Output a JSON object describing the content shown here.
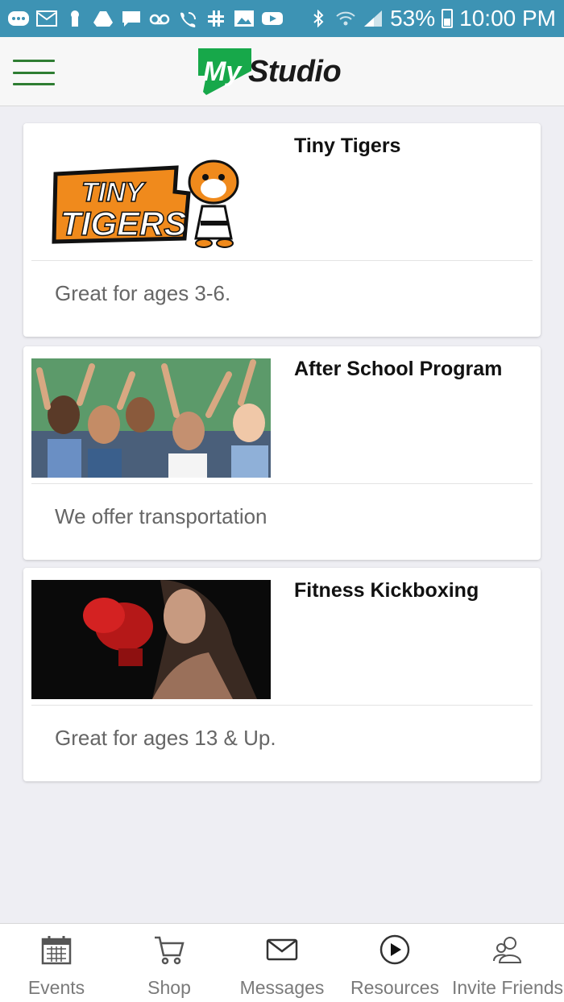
{
  "status_bar": {
    "battery_percent": "53%",
    "time": "10:00 PM",
    "icons": [
      "more-icon",
      "gmail-icon",
      "keyhole-icon",
      "drive-icon",
      "chat-icon",
      "voicemail-icon",
      "wifi-call-icon",
      "slack-icon",
      "image-icon",
      "youtube-icon",
      "bluetooth-icon",
      "wifi-icon",
      "signal-icon",
      "battery-icon"
    ]
  },
  "header": {
    "logo_my": "My",
    "logo_studio": "Studio",
    "brand_color": "#17a84a",
    "menu_color": "#2e7d32"
  },
  "cards": [
    {
      "title": "Tiny Tigers",
      "description": "Great for ages 3-6.",
      "image_text": "TINY TIGERS"
    },
    {
      "title": "After School Program",
      "description": "We offer transportation"
    },
    {
      "title": "Fitness Kickboxing",
      "description": "Great for ages 13 & Up."
    }
  ],
  "bottom_nav": [
    {
      "label": "Events",
      "icon": "calendar-icon"
    },
    {
      "label": "Shop",
      "icon": "cart-icon"
    },
    {
      "label": "Messages",
      "icon": "envelope-icon"
    },
    {
      "label": "Resources",
      "icon": "play-circle-icon"
    },
    {
      "label": "Invite Friends",
      "icon": "invite-friends-icon"
    }
  ]
}
